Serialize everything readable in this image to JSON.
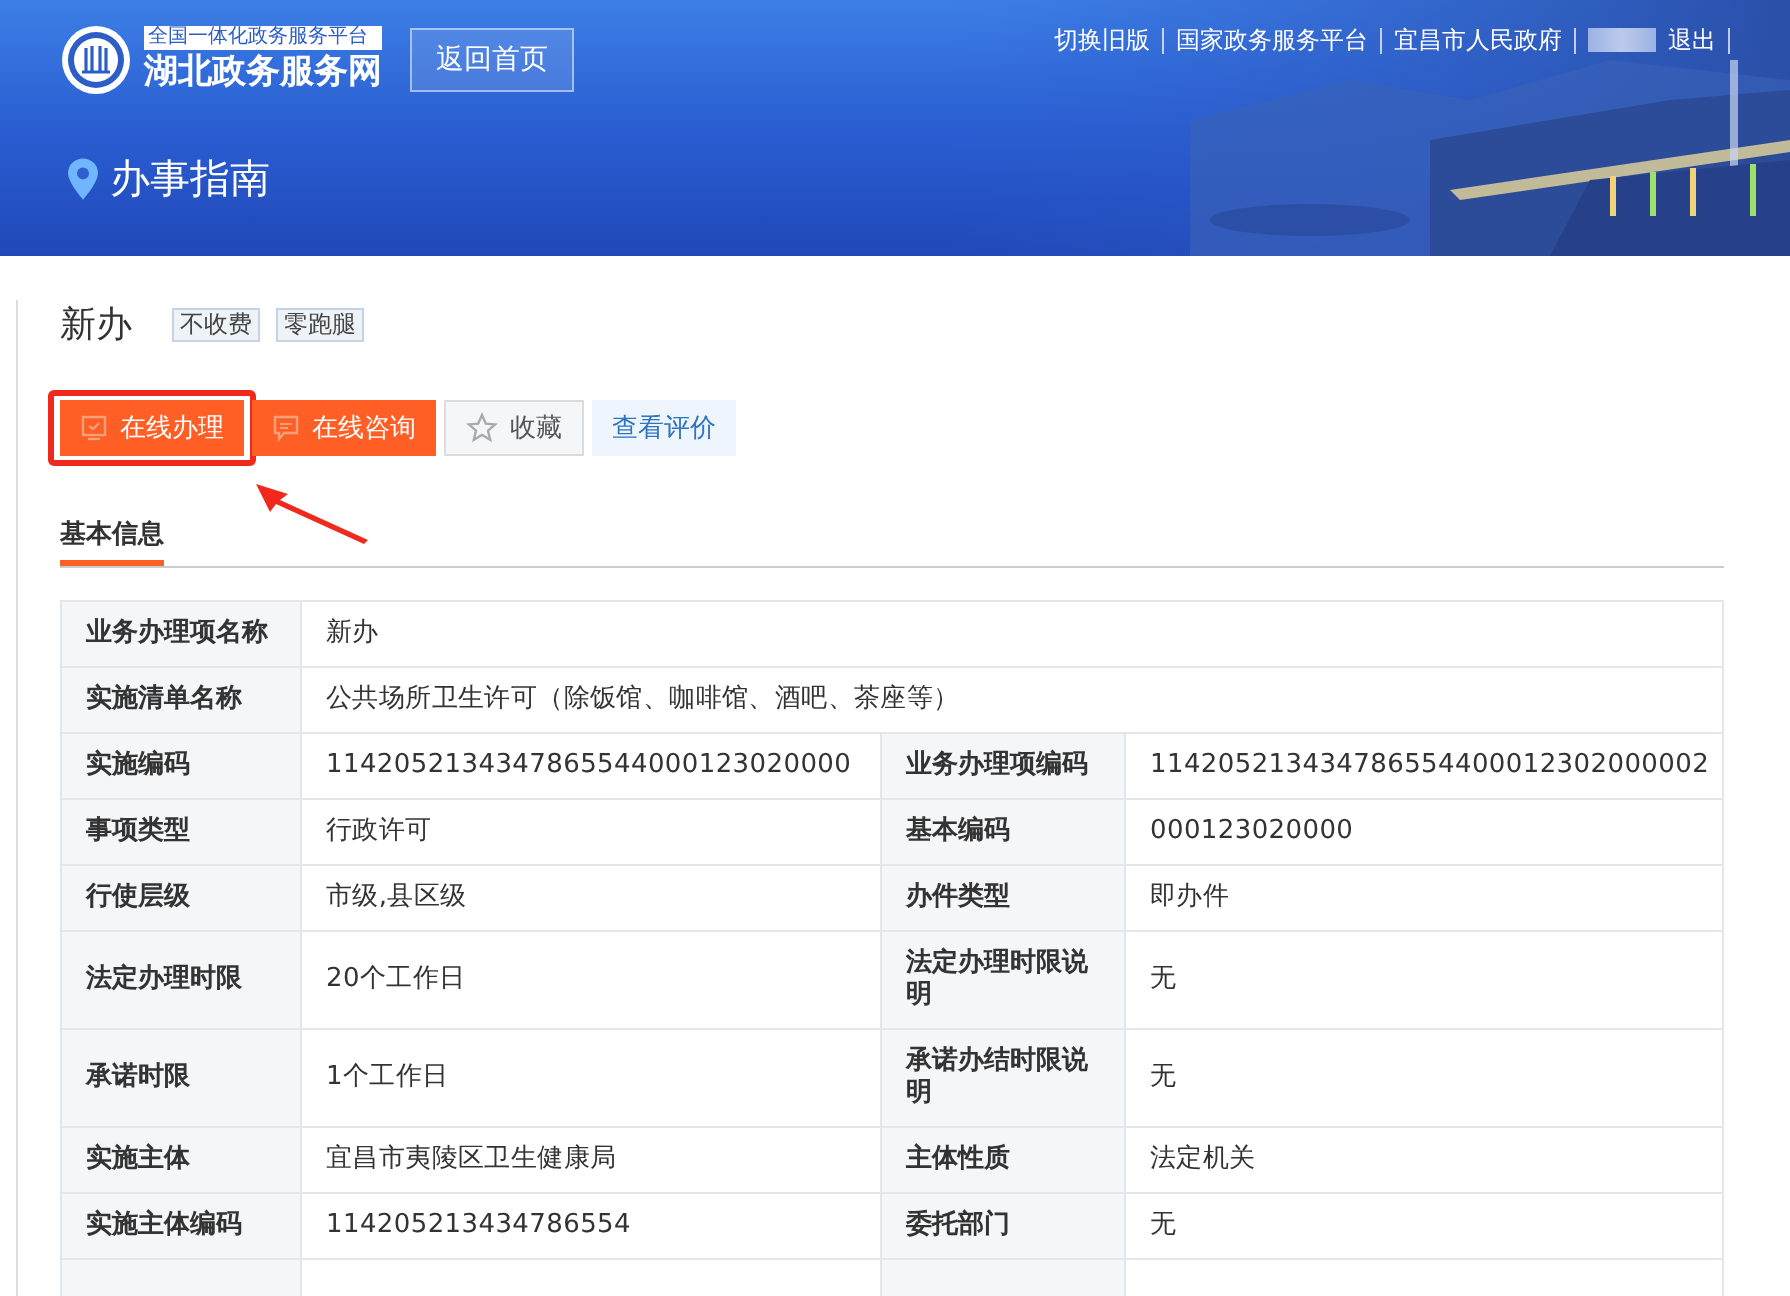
{
  "header": {
    "logo": {
      "subtitle": "全国一体化政务服务平台",
      "title": "湖北政务服务网"
    },
    "home_button": "返回首页",
    "top_links": [
      "切换旧版",
      "国家政务服务平台",
      "宜昌市人民政府"
    ],
    "logout": "退出",
    "page_title": "办事指南"
  },
  "item": {
    "title": "新办",
    "tags": [
      "不收费",
      "零跑腿"
    ]
  },
  "actions": [
    {
      "label": "在线办理",
      "kind": "handle",
      "annotated": true
    },
    {
      "label": "在线咨询",
      "kind": "consult",
      "annotated": false
    },
    {
      "label": "收藏",
      "kind": "favorite",
      "annotated": false
    },
    {
      "label": "查看评价",
      "kind": "review",
      "annotated": false
    }
  ],
  "tabs": [
    {
      "label": "基本信息",
      "selected": true
    }
  ],
  "table": {
    "rows": [
      {
        "cells": [
          {
            "label": "业务办理项名称",
            "value": "新办"
          }
        ]
      },
      {
        "cells": [
          {
            "label": "实施清单名称",
            "value": "公共场所卫生许可（除饭馆、咖啡馆、酒吧、茶座等）"
          }
        ]
      },
      {
        "cells": [
          {
            "label": "实施编码",
            "value": "1142052134347865544000123020000"
          },
          {
            "label": "业务办理项编码",
            "value": "114205213434786554400012302000002"
          }
        ]
      },
      {
        "cells": [
          {
            "label": "事项类型",
            "value": "行政许可"
          },
          {
            "label": "基本编码",
            "value": "000123020000"
          }
        ]
      },
      {
        "cells": [
          {
            "label": "行使层级",
            "value": "市级,县区级"
          },
          {
            "label": "办件类型",
            "value": "即办件"
          }
        ]
      },
      {
        "cells": [
          {
            "label": "法定办理时限",
            "value": "20个工作日"
          },
          {
            "label": "法定办理时限说明",
            "value": "无"
          }
        ]
      },
      {
        "cells": [
          {
            "label": "承诺时限",
            "value": "1个工作日"
          },
          {
            "label": "承诺办结时限说明",
            "value": "无"
          }
        ]
      },
      {
        "cells": [
          {
            "label": "实施主体",
            "value": "宜昌市夷陵区卫生健康局"
          },
          {
            "label": "主体性质",
            "value": "法定机关"
          }
        ]
      },
      {
        "cells": [
          {
            "label": "实施主体编码",
            "value": "114205213434786554"
          },
          {
            "label": "委托部门",
            "value": "无"
          }
        ]
      }
    ]
  }
}
